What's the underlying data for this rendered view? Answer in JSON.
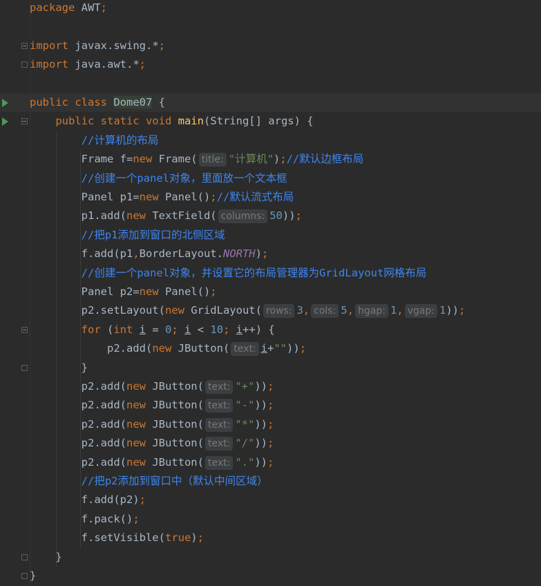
{
  "editor": {
    "lines": [
      {
        "segments": [
          {
            "t": "package",
            "c": "kw"
          },
          {
            "t": " AWT"
          },
          {
            "t": ";",
            "c": "kw"
          }
        ]
      },
      {
        "segments": []
      },
      {
        "segments": [
          {
            "t": "import",
            "c": "kw"
          },
          {
            "t": " javax.swing.*"
          },
          {
            "t": ";",
            "c": "kw"
          }
        ]
      },
      {
        "segments": [
          {
            "t": "import",
            "c": "kw"
          },
          {
            "t": " java.awt.*"
          },
          {
            "t": ";",
            "c": "kw"
          }
        ]
      },
      {
        "segments": []
      },
      {
        "segments": [
          {
            "t": "public class ",
            "c": "kw"
          },
          {
            "t": "Dome07",
            "c": "cls-hl"
          },
          {
            "t": " {"
          }
        ]
      },
      {
        "segments": [
          {
            "t": "    "
          },
          {
            "t": "public static void ",
            "c": "kw"
          },
          {
            "t": "main",
            "c": "fn"
          },
          {
            "t": "(String[] args) {"
          }
        ]
      },
      {
        "segments": [
          {
            "t": "        "
          },
          {
            "t": "//计算机的布局",
            "c": "cmt"
          }
        ]
      },
      {
        "segments": [
          {
            "t": "        Frame f="
          },
          {
            "t": "new ",
            "c": "kw"
          },
          {
            "t": "Frame("
          },
          {
            "t": "title:",
            "c": "hint"
          },
          {
            "t": "\"计算机\"",
            "c": "str"
          },
          {
            "t": ")"
          },
          {
            "t": ";",
            "c": "kw"
          },
          {
            "t": "//默认边框布局",
            "c": "cmt"
          }
        ]
      },
      {
        "segments": [
          {
            "t": "        "
          },
          {
            "t": "//创建一个panel对象，里面放一个文本框",
            "c": "cmt"
          }
        ]
      },
      {
        "segments": [
          {
            "t": "        Panel p1="
          },
          {
            "t": "new ",
            "c": "kw"
          },
          {
            "t": "Panel()"
          },
          {
            "t": ";",
            "c": "kw"
          },
          {
            "t": "//默认流式布局",
            "c": "cmt"
          }
        ]
      },
      {
        "segments": [
          {
            "t": "        p1.add("
          },
          {
            "t": "new ",
            "c": "kw"
          },
          {
            "t": "TextField("
          },
          {
            "t": "columns:",
            "c": "hint"
          },
          {
            "t": "50",
            "c": "num"
          },
          {
            "t": "))"
          },
          {
            "t": ";",
            "c": "kw"
          }
        ]
      },
      {
        "segments": [
          {
            "t": "        "
          },
          {
            "t": "//把p1添加到窗口的北侧区域",
            "c": "cmt"
          }
        ]
      },
      {
        "segments": [
          {
            "t": "        f.add(p1"
          },
          {
            "t": ",",
            "c": "kw"
          },
          {
            "t": "BorderLayout."
          },
          {
            "t": "NORTH",
            "c": "static-field"
          },
          {
            "t": ")"
          },
          {
            "t": ";",
            "c": "kw"
          }
        ]
      },
      {
        "segments": [
          {
            "t": "        "
          },
          {
            "t": "//创建一个panel对象，并设置它的布局管理器为GridLayout网格布局",
            "c": "cmt"
          }
        ]
      },
      {
        "segments": [
          {
            "t": "        Panel p2="
          },
          {
            "t": "new ",
            "c": "kw"
          },
          {
            "t": "Panel()"
          },
          {
            "t": ";",
            "c": "kw"
          }
        ]
      },
      {
        "segments": [
          {
            "t": "        p2.setLayout("
          },
          {
            "t": "new ",
            "c": "kw"
          },
          {
            "t": "GridLayout("
          },
          {
            "t": "rows:",
            "c": "hint"
          },
          {
            "t": "3",
            "c": "num"
          },
          {
            "t": ",",
            "c": "kw"
          },
          {
            "t": "cols:",
            "c": "hint"
          },
          {
            "t": "5",
            "c": "num"
          },
          {
            "t": ",",
            "c": "kw"
          },
          {
            "t": "hgap:",
            "c": "hint"
          },
          {
            "t": "1",
            "c": "num"
          },
          {
            "t": ",",
            "c": "kw"
          },
          {
            "t": "vgap:",
            "c": "hint"
          },
          {
            "t": "1",
            "c": "num"
          },
          {
            "t": "))"
          },
          {
            "t": ";",
            "c": "kw"
          }
        ]
      },
      {
        "segments": [
          {
            "t": "        "
          },
          {
            "t": "for ",
            "c": "kw"
          },
          {
            "t": "("
          },
          {
            "t": "int ",
            "c": "kw"
          },
          {
            "t": "i",
            "c": "ul"
          },
          {
            "t": " = "
          },
          {
            "t": "0",
            "c": "num"
          },
          {
            "t": "; ",
            "c": "kw"
          },
          {
            "t": "i",
            "c": "ul"
          },
          {
            "t": " < "
          },
          {
            "t": "10",
            "c": "num"
          },
          {
            "t": "; ",
            "c": "kw"
          },
          {
            "t": "i",
            "c": "ul"
          },
          {
            "t": "++) {"
          }
        ]
      },
      {
        "segments": [
          {
            "t": "            p2.add("
          },
          {
            "t": "new ",
            "c": "kw"
          },
          {
            "t": "JButton("
          },
          {
            "t": "text:",
            "c": "hint"
          },
          {
            "t": "i",
            "c": "ul"
          },
          {
            "t": "+"
          },
          {
            "t": "\"\"",
            "c": "str"
          },
          {
            "t": "))"
          },
          {
            "t": ";",
            "c": "kw"
          }
        ]
      },
      {
        "segments": [
          {
            "t": "        }"
          }
        ]
      },
      {
        "segments": [
          {
            "t": "        p2.add("
          },
          {
            "t": "new ",
            "c": "kw"
          },
          {
            "t": "JButton("
          },
          {
            "t": "text:",
            "c": "hint"
          },
          {
            "t": "\"+\"",
            "c": "str"
          },
          {
            "t": "))"
          },
          {
            "t": ";",
            "c": "kw"
          }
        ]
      },
      {
        "segments": [
          {
            "t": "        p2.add("
          },
          {
            "t": "new ",
            "c": "kw"
          },
          {
            "t": "JButton("
          },
          {
            "t": "text:",
            "c": "hint"
          },
          {
            "t": "\"-\"",
            "c": "str"
          },
          {
            "t": "))"
          },
          {
            "t": ";",
            "c": "kw"
          }
        ]
      },
      {
        "segments": [
          {
            "t": "        p2.add("
          },
          {
            "t": "new ",
            "c": "kw"
          },
          {
            "t": "JButton("
          },
          {
            "t": "text:",
            "c": "hint"
          },
          {
            "t": "\"*\"",
            "c": "str"
          },
          {
            "t": "))"
          },
          {
            "t": ";",
            "c": "kw"
          }
        ]
      },
      {
        "segments": [
          {
            "t": "        p2.add("
          },
          {
            "t": "new ",
            "c": "kw"
          },
          {
            "t": "JButton("
          },
          {
            "t": "text:",
            "c": "hint"
          },
          {
            "t": "\"/\"",
            "c": "str"
          },
          {
            "t": "))"
          },
          {
            "t": ";",
            "c": "kw"
          }
        ]
      },
      {
        "segments": [
          {
            "t": "        p2.add("
          },
          {
            "t": "new ",
            "c": "kw"
          },
          {
            "t": "JButton("
          },
          {
            "t": "text:",
            "c": "hint"
          },
          {
            "t": "\".\"",
            "c": "str"
          },
          {
            "t": "))"
          },
          {
            "t": ";",
            "c": "kw"
          }
        ]
      },
      {
        "segments": [
          {
            "t": "        "
          },
          {
            "t": "//把p2添加到窗口中（默认中间区域）",
            "c": "cmt"
          }
        ]
      },
      {
        "segments": [
          {
            "t": "        f.add(p2)"
          },
          {
            "t": ";",
            "c": "kw"
          }
        ]
      },
      {
        "segments": [
          {
            "t": "        f.pack()"
          },
          {
            "t": ";",
            "c": "kw"
          }
        ]
      },
      {
        "segments": [
          {
            "t": "        f.setVisible("
          },
          {
            "t": "true",
            "c": "kw"
          },
          {
            "t": ")"
          },
          {
            "t": ";",
            "c": "kw"
          }
        ]
      },
      {
        "segments": [
          {
            "t": "    }"
          }
        ]
      },
      {
        "segments": [
          {
            "t": "}"
          }
        ]
      }
    ]
  },
  "gutter": {
    "run_icons": [
      {
        "line": 6,
        "icon": "run-class-icon"
      },
      {
        "line": 7,
        "icon": "run-method-icon"
      }
    ],
    "fold_markers": [
      {
        "line": 3,
        "state": "open"
      },
      {
        "line": 4,
        "state": "closed"
      },
      {
        "line": 7,
        "state": "open"
      },
      {
        "line": 18,
        "state": "open"
      },
      {
        "line": 20,
        "state": "closed"
      },
      {
        "line": 30,
        "state": "closed"
      },
      {
        "line": 31,
        "state": "closed"
      }
    ],
    "current_line": 6
  },
  "colors": {
    "background": "#2b2b2b",
    "keyword": "#cc7832",
    "string": "#6a8759",
    "number": "#6897bb",
    "comment": "#3e86f0",
    "method": "#ffc66d",
    "static_field": "#9876aa",
    "run_icon": "#499c54"
  }
}
